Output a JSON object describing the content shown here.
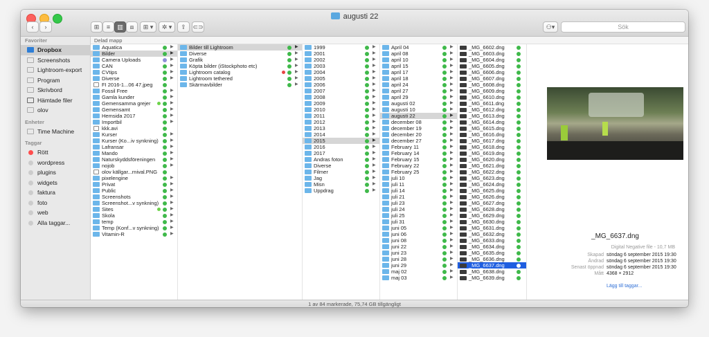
{
  "window": {
    "title": "augusti 22"
  },
  "toolbar": {
    "back": "‹",
    "forward": "›",
    "view_icon": "⊞",
    "view_list": "≡",
    "view_column": "▥",
    "view_cover": "⧈",
    "arrange": "⊞ ▾",
    "action": "✲ ▾",
    "share": "⇪",
    "tag": "⊂⊃",
    "dropbox": "⚇▾",
    "search_placeholder": "Sök"
  },
  "sidebar": {
    "sections": [
      {
        "title": "Favoriter",
        "items": [
          {
            "label": "Dropbox",
            "icon": "dropbox-icon",
            "selected": true
          },
          {
            "label": "Screenshots",
            "icon": "folder-icon"
          },
          {
            "label": "Lightroom-export",
            "icon": "folder-icon"
          },
          {
            "label": "Program",
            "icon": "apps-icon"
          },
          {
            "label": "Skrivbord",
            "icon": "desktop-icon"
          },
          {
            "label": "Hämtade filer",
            "icon": "download-icon"
          },
          {
            "label": "olov",
            "icon": "home-icon"
          }
        ]
      },
      {
        "title": "Enheter",
        "items": [
          {
            "label": "Time Machine",
            "icon": "disk-icon"
          }
        ]
      },
      {
        "title": "Taggar",
        "items": [
          {
            "label": "Rött",
            "icon": "tag-red-icon",
            "tag": "red"
          },
          {
            "label": "wordpress",
            "icon": "tag-icon"
          },
          {
            "label": "plugins",
            "icon": "tag-icon"
          },
          {
            "label": "widgets",
            "icon": "tag-icon"
          },
          {
            "label": "faktura",
            "icon": "tag-icon"
          },
          {
            "label": "foto",
            "icon": "tag-icon"
          },
          {
            "label": "web",
            "icon": "tag-icon"
          },
          {
            "label": "Alla taggar...",
            "icon": "tag-icon"
          }
        ]
      }
    ]
  },
  "column_header": "Delad mapp",
  "columns": [
    {
      "items": [
        {
          "label": "Aquatica",
          "type": "folder"
        },
        {
          "label": "Bilder",
          "type": "folder",
          "selected": true
        },
        {
          "label": "Camera Uploads",
          "type": "folder",
          "status": "syncing"
        },
        {
          "label": "CAN",
          "type": "folder"
        },
        {
          "label": "CVtips",
          "type": "folder"
        },
        {
          "label": "Diverse",
          "type": "folder"
        },
        {
          "label": "FI 2016-1...06 47.jpeg",
          "type": "file"
        },
        {
          "label": "Fossil Free",
          "type": "folder"
        },
        {
          "label": "Gamla kunder",
          "type": "folder"
        },
        {
          "label": "Gemensamma grejer",
          "type": "folder",
          "dot": "#6dd34a"
        },
        {
          "label": "Gemensamt",
          "type": "folder"
        },
        {
          "label": "Hemsida 2017",
          "type": "folder"
        },
        {
          "label": "Importbil",
          "type": "folder"
        },
        {
          "label": "kkk.avi",
          "type": "file"
        },
        {
          "label": "Kurser",
          "type": "folder"
        },
        {
          "label": "Kurser (Ko...iv synkning)",
          "type": "folder"
        },
        {
          "label": "Lafransar",
          "type": "folder"
        },
        {
          "label": "Mando",
          "type": "folder"
        },
        {
          "label": "Naturskyddsföreningen",
          "type": "folder"
        },
        {
          "label": "nojob",
          "type": "folder"
        },
        {
          "label": "olov källgar...rnival.PNG",
          "type": "file"
        },
        {
          "label": "pixelengine",
          "type": "folder"
        },
        {
          "label": "Privat",
          "type": "folder"
        },
        {
          "label": "Public",
          "type": "folder"
        },
        {
          "label": "Screenshots",
          "type": "folder"
        },
        {
          "label": "Screenshot...v synkning)",
          "type": "folder"
        },
        {
          "label": "Sites",
          "type": "folder",
          "dot": "#6dd34a"
        },
        {
          "label": "Skola",
          "type": "folder"
        },
        {
          "label": "temp",
          "type": "folder"
        },
        {
          "label": "Temp (Konf...v synkning)",
          "type": "folder"
        },
        {
          "label": "Vitamin-R",
          "type": "folder"
        }
      ]
    },
    {
      "items": [
        {
          "label": "Bilder till Lightroom",
          "type": "folder",
          "selected": true
        },
        {
          "label": "Diverse",
          "type": "folder"
        },
        {
          "label": "Grafik",
          "type": "folder"
        },
        {
          "label": "Köpta bilder (iStockphoto etc)",
          "type": "folder"
        },
        {
          "label": "Lightroom catalog",
          "type": "folder",
          "dot": "#e84545"
        },
        {
          "label": "Lightroom tethered",
          "type": "folder"
        },
        {
          "label": "Skärmavbilder",
          "type": "folder"
        }
      ]
    },
    {
      "items": [
        {
          "label": "1999",
          "type": "folder"
        },
        {
          "label": "2001",
          "type": "folder"
        },
        {
          "label": "2002",
          "type": "folder"
        },
        {
          "label": "2003",
          "type": "folder"
        },
        {
          "label": "2004",
          "type": "folder"
        },
        {
          "label": "2005",
          "type": "folder"
        },
        {
          "label": "2006",
          "type": "folder"
        },
        {
          "label": "2007",
          "type": "folder"
        },
        {
          "label": "2008",
          "type": "folder"
        },
        {
          "label": "2009",
          "type": "folder"
        },
        {
          "label": "2010",
          "type": "folder"
        },
        {
          "label": "2011",
          "type": "folder"
        },
        {
          "label": "2012",
          "type": "folder"
        },
        {
          "label": "2013",
          "type": "folder"
        },
        {
          "label": "2014",
          "type": "folder"
        },
        {
          "label": "2015",
          "type": "folder",
          "selected": true
        },
        {
          "label": "2016",
          "type": "folder"
        },
        {
          "label": "2017",
          "type": "folder"
        },
        {
          "label": "Andras foton",
          "type": "folder"
        },
        {
          "label": "Diverse",
          "type": "folder"
        },
        {
          "label": "Filmer",
          "type": "folder"
        },
        {
          "label": "Jag",
          "type": "folder"
        },
        {
          "label": "Misn",
          "type": "folder"
        },
        {
          "label": "Uppdrag",
          "type": "folder"
        }
      ]
    },
    {
      "items": [
        {
          "label": "April 04",
          "type": "folder"
        },
        {
          "label": "april 08",
          "type": "folder"
        },
        {
          "label": "april 10",
          "type": "folder"
        },
        {
          "label": "april 15",
          "type": "folder"
        },
        {
          "label": "april 17",
          "type": "folder"
        },
        {
          "label": "april 18",
          "type": "folder"
        },
        {
          "label": "april 24",
          "type": "folder"
        },
        {
          "label": "april 27",
          "type": "folder"
        },
        {
          "label": "april 29",
          "type": "folder"
        },
        {
          "label": "augusti 02",
          "type": "folder"
        },
        {
          "label": "augusti 10",
          "type": "folder"
        },
        {
          "label": "augusti 22",
          "type": "folder",
          "selected": true
        },
        {
          "label": "december 08",
          "type": "folder"
        },
        {
          "label": "december 19",
          "type": "folder"
        },
        {
          "label": "december 20",
          "type": "folder"
        },
        {
          "label": "december 27",
          "type": "folder"
        },
        {
          "label": "February 11",
          "type": "folder"
        },
        {
          "label": "February 14",
          "type": "folder"
        },
        {
          "label": "February 15",
          "type": "folder"
        },
        {
          "label": "February 22",
          "type": "folder"
        },
        {
          "label": "February 25",
          "type": "folder"
        },
        {
          "label": "juli 10",
          "type": "folder"
        },
        {
          "label": "juli 11",
          "type": "folder"
        },
        {
          "label": "juli 14",
          "type": "folder"
        },
        {
          "label": "juli 21",
          "type": "folder"
        },
        {
          "label": "juli 23",
          "type": "folder"
        },
        {
          "label": "juli 24",
          "type": "folder"
        },
        {
          "label": "juli 25",
          "type": "folder"
        },
        {
          "label": "juli 31",
          "type": "folder"
        },
        {
          "label": "juni 05",
          "type": "folder"
        },
        {
          "label": "juni 06",
          "type": "folder"
        },
        {
          "label": "juni 08",
          "type": "folder"
        },
        {
          "label": "juni 22",
          "type": "folder"
        },
        {
          "label": "juni 23",
          "type": "folder"
        },
        {
          "label": "juni 28",
          "type": "folder"
        },
        {
          "label": "juni 29",
          "type": "folder"
        },
        {
          "label": "maj 02",
          "type": "folder"
        },
        {
          "label": "maj 03",
          "type": "folder"
        }
      ]
    },
    {
      "items": [
        {
          "label": "_MG_6602.dng",
          "type": "dng"
        },
        {
          "label": "_MG_6603.dng",
          "type": "dng"
        },
        {
          "label": "_MG_6604.dng",
          "type": "dng"
        },
        {
          "label": "_MG_6605.dng",
          "type": "dng"
        },
        {
          "label": "_MG_6606.dng",
          "type": "dng"
        },
        {
          "label": "_MG_6607.dng",
          "type": "dng"
        },
        {
          "label": "_MG_6608.dng",
          "type": "dng"
        },
        {
          "label": "_MG_6609.dng",
          "type": "dng"
        },
        {
          "label": "_MG_6610.dng",
          "type": "dng"
        },
        {
          "label": "_MG_6611.dng",
          "type": "dng"
        },
        {
          "label": "_MG_6612.dng",
          "type": "dng"
        },
        {
          "label": "_MG_6613.dng",
          "type": "dng"
        },
        {
          "label": "_MG_6614.dng",
          "type": "dng"
        },
        {
          "label": "_MG_6615.dng",
          "type": "dng"
        },
        {
          "label": "_MG_6616.dng",
          "type": "dng"
        },
        {
          "label": "_MG_6617.dng",
          "type": "dng"
        },
        {
          "label": "_MG_6618.dng",
          "type": "dng"
        },
        {
          "label": "_MG_6619.dng",
          "type": "dng"
        },
        {
          "label": "_MG_6620.dng",
          "type": "dng"
        },
        {
          "label": "_MG_6621.dng",
          "type": "dng"
        },
        {
          "label": "_MG_6622.dng",
          "type": "dng"
        },
        {
          "label": "_MG_6623.dng",
          "type": "dng"
        },
        {
          "label": "_MG_6624.dng",
          "type": "dng"
        },
        {
          "label": "_MG_6625.dng",
          "type": "dng"
        },
        {
          "label": "_MG_6626.dng",
          "type": "dng"
        },
        {
          "label": "_MG_6627.dng",
          "type": "dng"
        },
        {
          "label": "_MG_6628.dng",
          "type": "dng"
        },
        {
          "label": "_MG_6629.dng",
          "type": "dng"
        },
        {
          "label": "_MG_6630.dng",
          "type": "dng"
        },
        {
          "label": "_MG_6631.dng",
          "type": "dng"
        },
        {
          "label": "_MG_6632.dng",
          "type": "dng"
        },
        {
          "label": "_MG_6633.dng",
          "type": "dng"
        },
        {
          "label": "_MG_6634.dng",
          "type": "dng"
        },
        {
          "label": "_MG_6635.dng",
          "type": "dng"
        },
        {
          "label": "_MG_6636.dng",
          "type": "dng"
        },
        {
          "label": "_MG_6637.dng",
          "type": "dng",
          "highlighted": true
        },
        {
          "label": "_MG_6638.dng",
          "type": "dng"
        },
        {
          "label": "_MG_6639.dng",
          "type": "dng"
        }
      ]
    }
  ],
  "preview": {
    "filename": "_MG_6637.dng",
    "kind": "Digital Negative file - 10,7 MB",
    "meta": [
      {
        "key": "Skapad",
        "value": "söndag 6 september 2015 19:30"
      },
      {
        "key": "Ändrad",
        "value": "söndag 6 september 2015 19:30"
      },
      {
        "key": "Senast öppnad",
        "value": "söndag 6 september 2015 19:30"
      },
      {
        "key": "Mått",
        "value": "4368 × 2912"
      }
    ],
    "add_tags": "Lägg till taggar..."
  },
  "status": "1 av 84 markerade, 75,74 GB tillgängligt",
  "colors": {
    "accent": "#1f5ee0",
    "folder": "#6cb6ea",
    "synced": "#3fb94a"
  }
}
